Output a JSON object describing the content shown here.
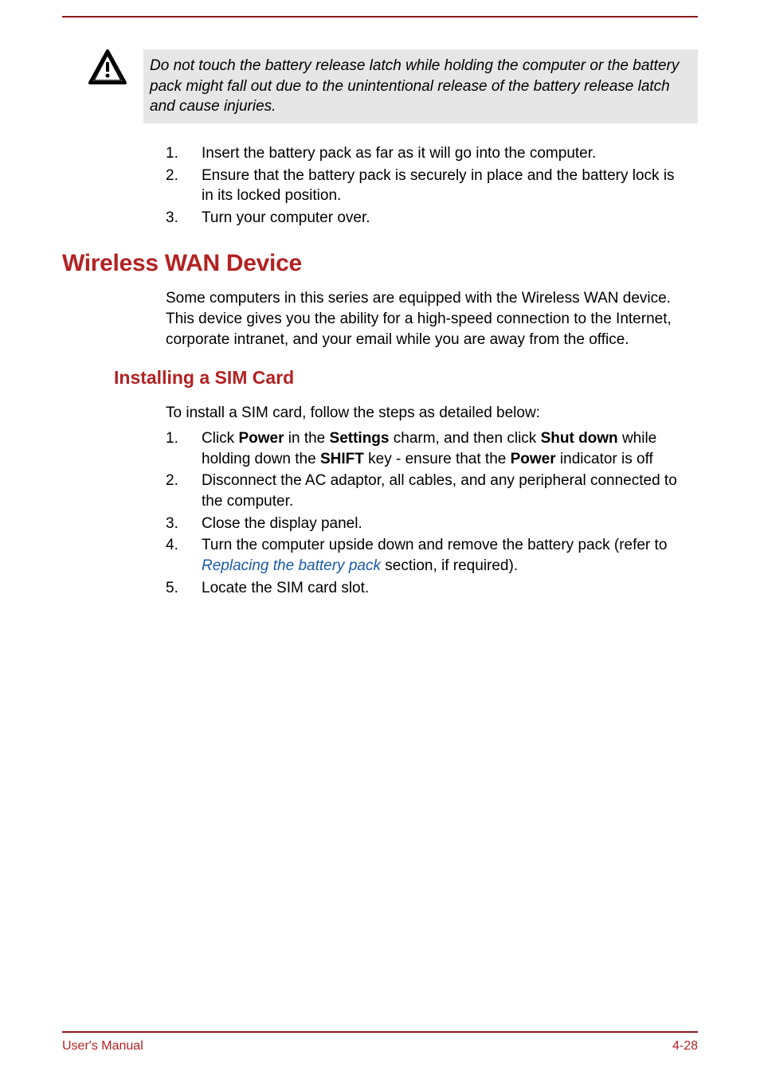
{
  "warning": {
    "text": "Do not touch the battery release latch while holding the computer or the battery pack might fall out due to the unintentional release of the battery release latch and cause injuries."
  },
  "topList": {
    "items": [
      {
        "num": "1.",
        "text": "Insert the battery pack as far as it will go into the computer."
      },
      {
        "num": "2.",
        "text": "Ensure that the battery pack is securely in place and the battery lock is in its locked position."
      },
      {
        "num": "3.",
        "text": "Turn your computer over."
      }
    ]
  },
  "section1": {
    "title": "Wireless WAN Device",
    "para": "Some computers in this series are equipped with the Wireless WAN device. This device gives you the ability for a high-speed connection to the Internet, corporate intranet, and your email while you are away from the office."
  },
  "section2": {
    "title": "Installing a SIM Card",
    "intro": "To install a SIM card, follow the steps as detailed below:",
    "items": [
      {
        "num": "1.",
        "html": "Click <span class='bold'>Power</span> in the <span class='bold'>Settings</span> charm, and then click <span class='bold'>Shut down</span> while holding down the <span class='bold'>SHIFT</span> key - ensure that the <span class='bold'>Power</span> indicator is off"
      },
      {
        "num": "2.",
        "text": "Disconnect the AC adaptor, all cables, and any peripheral connected to the computer."
      },
      {
        "num": "3.",
        "text": "Close the display panel."
      },
      {
        "num": "4.",
        "html": "Turn the computer upside down and remove the battery pack (refer to <span class='link'>Replacing the battery pack</span> section, if required)."
      },
      {
        "num": "5.",
        "text": "Locate the SIM card slot."
      }
    ]
  },
  "footer": {
    "left": "User's Manual",
    "right": "4-28"
  }
}
